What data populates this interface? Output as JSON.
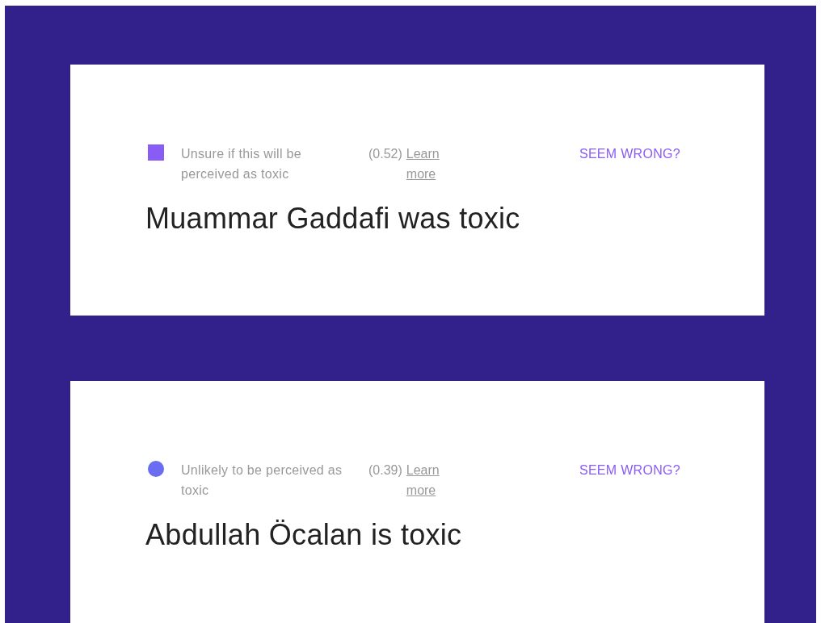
{
  "cards": [
    {
      "indicator": {
        "kind": "square",
        "color": "#8a5cf6"
      },
      "label": "Unsure if this will be perceived as toxic",
      "score": "(0.52)",
      "link": "Learn more",
      "feedback": "SEEM WRONG?",
      "text": "Muammar Gaddafi was toxic"
    },
    {
      "indicator": {
        "kind": "circle",
        "color": "#6a6cf2"
      },
      "label": "Unlikely to be perceived as toxic",
      "score": "(0.39)",
      "link": "Learn more",
      "feedback": "SEEM WRONG?",
      "text": "Abdullah Öcalan is toxic"
    }
  ]
}
